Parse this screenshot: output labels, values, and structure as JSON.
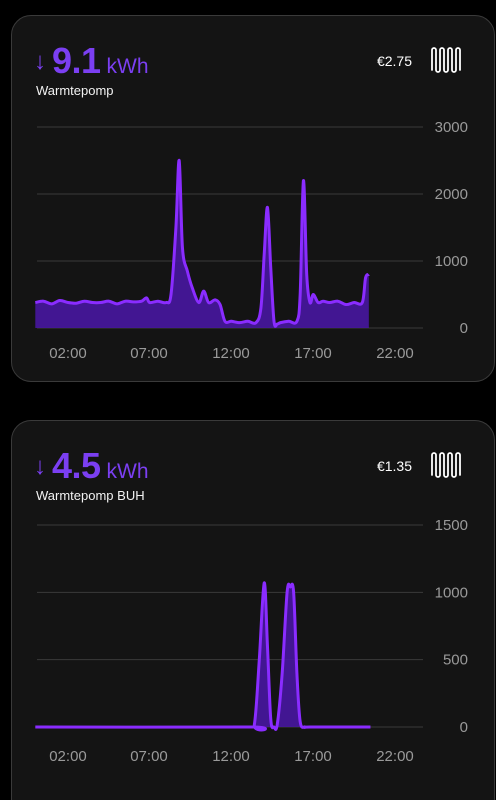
{
  "cards": [
    {
      "arrow": "↓",
      "value": "9.1",
      "unit": "kWh",
      "name": "Warmtepomp",
      "cost": "€2.75",
      "icon": "radiator-icon",
      "accent": "#7b3ff2",
      "chart_data": {
        "type": "area",
        "x_ticks": [
          "02:00",
          "07:00",
          "12:00",
          "17:00",
          "22:00"
        ],
        "y_ticks": [
          "3000",
          "2000",
          "1000",
          "0"
        ],
        "ylim": [
          0,
          3000
        ],
        "grid": true,
        "series": [
          {
            "x": [
              0.0,
              0.5,
              1.0,
              1.5,
              2.0,
              2.5,
              3.0,
              3.5,
              4.0,
              4.5,
              5.0,
              5.5,
              6.0,
              6.5,
              6.8,
              7.0,
              7.5,
              8.0,
              8.3,
              8.6,
              8.8,
              9.0,
              9.3,
              9.6,
              10.0,
              10.3,
              10.6,
              11.0,
              11.3,
              11.6,
              12.0,
              12.5,
              13.0,
              13.5,
              13.8,
              14.0,
              14.2,
              14.4,
              14.6,
              14.8,
              15.0,
              15.5,
              16.0,
              16.2,
              16.4,
              16.6,
              16.8,
              17.0,
              17.3,
              17.6,
              18.0,
              18.5,
              19.0,
              19.5,
              20.0,
              20.2,
              20.4
            ],
            "y": [
              380,
              400,
              360,
              410,
              380,
              370,
              400,
              380,
              380,
              400,
              360,
              400,
              390,
              400,
              450,
              380,
              400,
              380,
              500,
              1500,
              2500,
              1200,
              850,
              600,
              380,
              550,
              380,
              420,
              350,
              100,
              100,
              80,
              100,
              80,
              300,
              1100,
              1800,
              900,
              100,
              60,
              80,
              100,
              100,
              500,
              2200,
              800,
              380,
              500,
              380,
              400,
              380,
              400,
              350,
              380,
              380,
              750,
              800
            ]
          }
        ],
        "x_min": 0.0,
        "x_max": 22.0
      }
    },
    {
      "arrow": "↓",
      "value": "4.5",
      "unit": "kWh",
      "name": "Warmtepomp BUH",
      "cost": "€1.35",
      "icon": "radiator-icon",
      "accent": "#7b3ff2",
      "chart_data": {
        "type": "area",
        "x_ticks": [
          "02:00",
          "07:00",
          "12:00",
          "17:00",
          "22:00"
        ],
        "y_ticks": [
          "1500",
          "1000",
          "500",
          "0"
        ],
        "ylim": [
          0,
          1500
        ],
        "grid": true,
        "series": [
          {
            "x": [
              0.0,
              13.0,
              13.4,
              13.7,
              14.0,
              14.2,
              14.4,
              14.6,
              14.8,
              15.1,
              15.4,
              15.6,
              15.8,
              16.0,
              16.2,
              16.5,
              16.8,
              20.5
            ],
            "y": [
              0,
              0,
              20,
              500,
              1070,
              600,
              60,
              0,
              20,
              400,
              1000,
              1040,
              1000,
              400,
              40,
              0,
              0,
              0
            ]
          }
        ],
        "x_min": 0.0,
        "x_max": 22.0
      }
    }
  ]
}
